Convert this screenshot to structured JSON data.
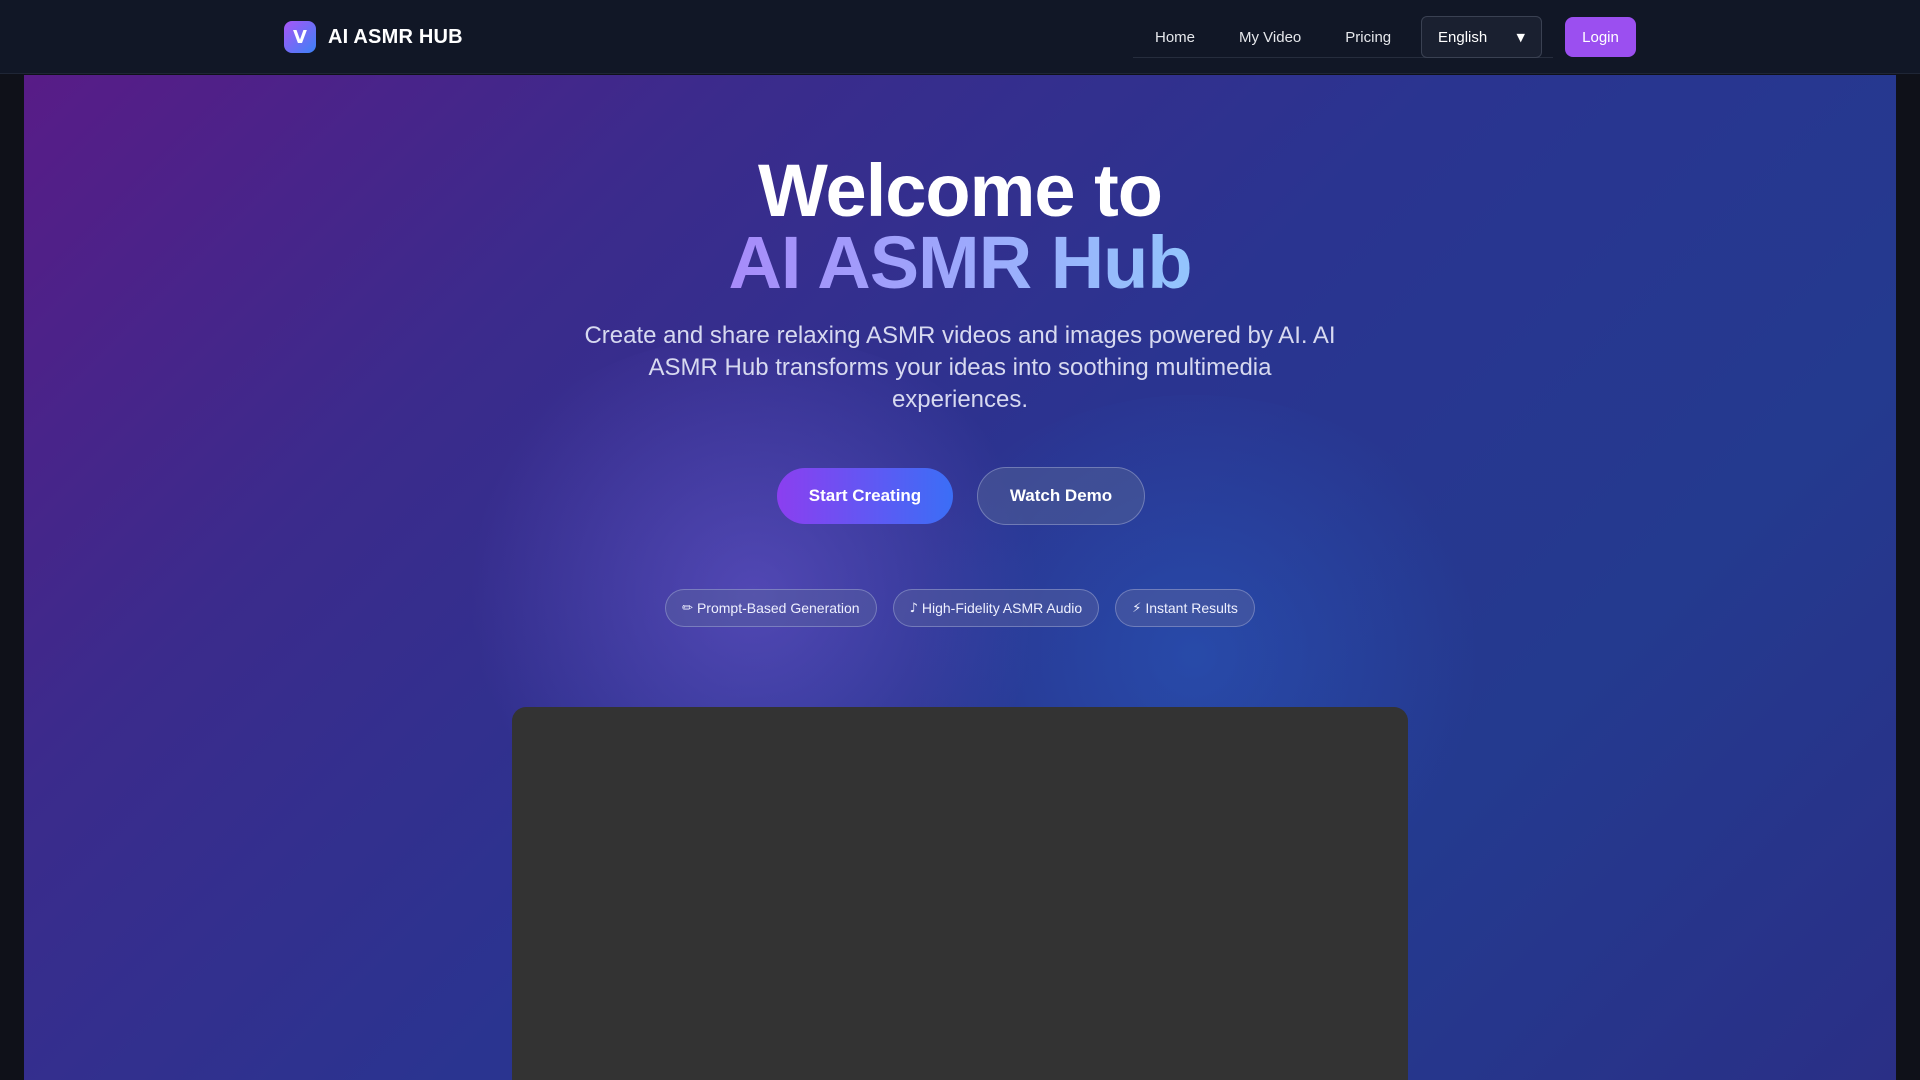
{
  "header": {
    "logo_letter": "V",
    "brand_name": "AI ASMR HUB",
    "nav": [
      {
        "label": "Home"
      },
      {
        "label": "My Video"
      },
      {
        "label": "Pricing"
      }
    ],
    "language": "English",
    "login_label": "Login"
  },
  "hero": {
    "headline_line1": "Welcome to",
    "headline_line2": "AI ASMR Hub",
    "subtitle": "Create and share relaxing ASMR videos and images powered by AI. AI ASMR Hub transforms your ideas into soothing multimedia experiences.",
    "primary_cta": "Start Creating",
    "secondary_cta": "Watch Demo",
    "features": [
      {
        "icon": "✏",
        "label": "Prompt-Based Generation"
      },
      {
        "icon": "♪",
        "label": "High-Fidelity ASMR Audio"
      },
      {
        "icon": "⚡",
        "label": "Instant Results"
      }
    ]
  },
  "colors": {
    "header_bg": "#111726",
    "accent_purple": "#9b4ff0",
    "accent_blue": "#3b6ef6",
    "video_panel_bg": "#333333"
  }
}
